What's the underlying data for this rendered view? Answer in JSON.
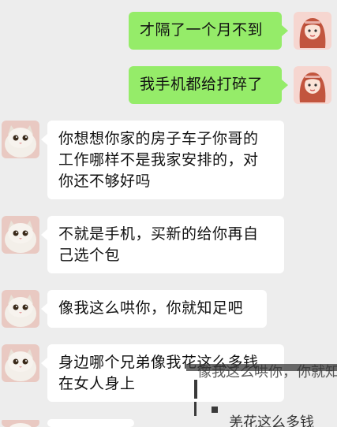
{
  "messages": [
    {
      "side": "me",
      "text": "才隔了一个月不到"
    },
    {
      "side": "me",
      "text": "我手机都给打碎了"
    },
    {
      "side": "other",
      "lines": [
        "你想想你家的房子车子你哥的",
        "工作哪样不是我家安排的，对",
        "你还不够好吗"
      ]
    },
    {
      "side": "other",
      "lines": [
        "不就是手机，买新的给你再自",
        "己选个包"
      ]
    },
    {
      "side": "other",
      "lines": [
        "像我这么哄你，你就知足吧"
      ]
    },
    {
      "side": "other",
      "lines": [
        "身边哪个兄弟像我花这么多钱",
        "在女人身上"
      ]
    }
  ],
  "overlay_text": {
    "top": "像我这么哄你，你就知足吧",
    "bottom": "羌花这么多钱"
  },
  "colors": {
    "me_bubble": "#95ec69",
    "other_bubble": "#ffffff",
    "background": "#ededed"
  },
  "icons": {
    "me_avatar": "girl-avatar-icon",
    "other_avatar": "cat-avatar-icon"
  }
}
